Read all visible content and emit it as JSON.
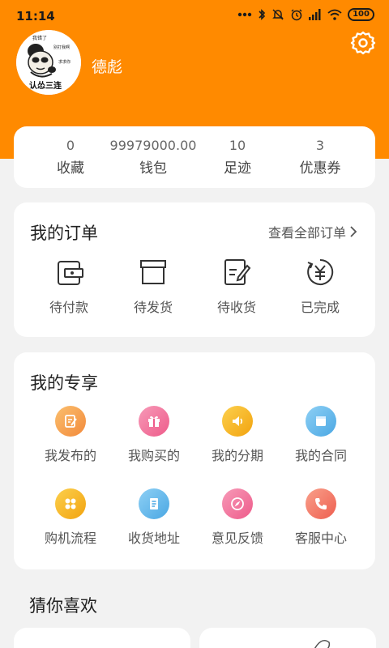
{
  "status_bar": {
    "time": "11:14",
    "battery": "100"
  },
  "profile": {
    "username": "德彪",
    "avatar_text_top": "我错了",
    "avatar_text_right1": "别打我啊",
    "avatar_text_right2": "求求你",
    "avatar_text_bottom": "认怂三连"
  },
  "stats": [
    {
      "value": "0",
      "label": "收藏"
    },
    {
      "value": "99979000.00",
      "label": "钱包"
    },
    {
      "value": "10",
      "label": "足迹"
    },
    {
      "value": "3",
      "label": "优惠券"
    }
  ],
  "orders": {
    "title": "我的订单",
    "view_all": "查看全部订单",
    "items": [
      {
        "label": "待付款",
        "icon": "wallet-icon"
      },
      {
        "label": "待发货",
        "icon": "box-icon"
      },
      {
        "label": "待收货",
        "icon": "receipt-icon"
      },
      {
        "label": "已完成",
        "icon": "yuan-icon"
      }
    ]
  },
  "exclusive": {
    "title": "我的专享",
    "items": [
      {
        "label": "我发布的",
        "icon": "edit-icon",
        "color": "#f6a04d"
      },
      {
        "label": "我购买的",
        "icon": "gift-icon",
        "color": "#f2719b"
      },
      {
        "label": "我的分期",
        "icon": "speaker-icon",
        "color": "#f7b628"
      },
      {
        "label": "我的合同",
        "icon": "calendar-icon",
        "color": "#5db5e8"
      },
      {
        "label": "购机流程",
        "icon": "grid-icon",
        "color": "#f7b628"
      },
      {
        "label": "收货地址",
        "icon": "document-icon",
        "color": "#5db5e8"
      },
      {
        "label": "意见反馈",
        "icon": "compass-icon",
        "color": "#f2719b"
      },
      {
        "label": "客服中心",
        "icon": "phone-icon",
        "color": "#f57f6a"
      }
    ]
  },
  "recommend": {
    "title": "猜你喜欢"
  }
}
